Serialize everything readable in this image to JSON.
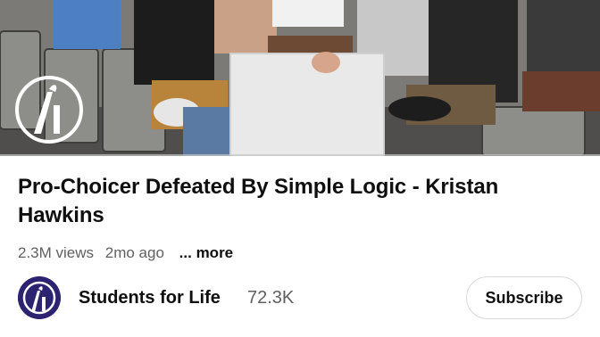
{
  "video": {
    "title": "Pro-Choicer Defeated By Simple Logic - Kristan Hawkins",
    "progress_fraction": 0.0,
    "thumbnail_description_icon": "video-frame"
  },
  "meta": {
    "views": "2.3M views",
    "age": "2mo ago",
    "more": "... more"
  },
  "channel": {
    "name": "Students for Life",
    "subscribers": "72.3K",
    "avatar_icon": "students-for-life-logo"
  },
  "actions": {
    "subscribe_label": "Subscribe"
  },
  "colors": {
    "brand_purple": "#2c2471",
    "progress_red": "#ff0000",
    "secondary_text": "#606060"
  }
}
